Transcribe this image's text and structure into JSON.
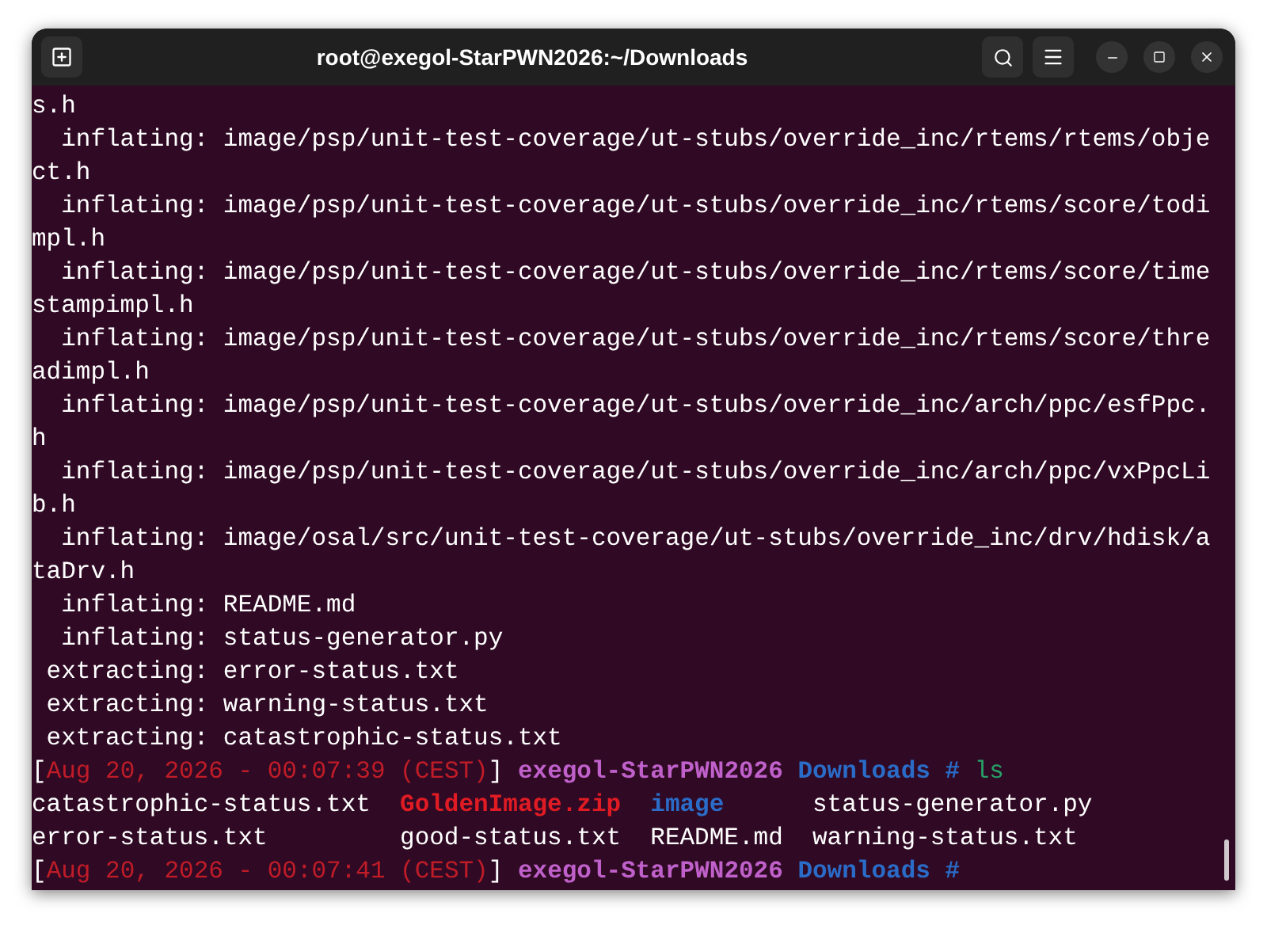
{
  "window": {
    "title": "root@exegol-StarPWN2026:~/Downloads"
  },
  "lines": [
    [
      {
        "kind": "plain",
        "text": "s.h"
      }
    ],
    [
      {
        "kind": "plain",
        "text": "  inflating: image/psp/unit-test-coverage/ut-stubs/override_inc/rtems/rtems/obje"
      }
    ],
    [
      {
        "kind": "plain",
        "text": "ct.h"
      }
    ],
    [
      {
        "kind": "plain",
        "text": "  inflating: image/psp/unit-test-coverage/ut-stubs/override_inc/rtems/score/todi"
      }
    ],
    [
      {
        "kind": "plain",
        "text": "mpl.h"
      }
    ],
    [
      {
        "kind": "plain",
        "text": "  inflating: image/psp/unit-test-coverage/ut-stubs/override_inc/rtems/score/time"
      }
    ],
    [
      {
        "kind": "plain",
        "text": "stampimpl.h"
      }
    ],
    [
      {
        "kind": "plain",
        "text": "  inflating: image/psp/unit-test-coverage/ut-stubs/override_inc/rtems/score/thre"
      }
    ],
    [
      {
        "kind": "plain",
        "text": "adimpl.h"
      }
    ],
    [
      {
        "kind": "plain",
        "text": "  inflating: image/psp/unit-test-coverage/ut-stubs/override_inc/arch/ppc/esfPpc."
      }
    ],
    [
      {
        "kind": "plain",
        "text": "h"
      }
    ],
    [
      {
        "kind": "plain",
        "text": "  inflating: image/psp/unit-test-coverage/ut-stubs/override_inc/arch/ppc/vxPpcLi"
      }
    ],
    [
      {
        "kind": "plain",
        "text": "b.h"
      }
    ],
    [
      {
        "kind": "plain",
        "text": "  inflating: image/osal/src/unit-test-coverage/ut-stubs/override_inc/drv/hdisk/a"
      }
    ],
    [
      {
        "kind": "plain",
        "text": "taDrv.h"
      }
    ],
    [
      {
        "kind": "plain",
        "text": "  inflating: README.md"
      }
    ],
    [
      {
        "kind": "plain",
        "text": "  inflating: status-generator.py"
      }
    ],
    [
      {
        "kind": "plain",
        "text": " extracting: error-status.txt"
      }
    ],
    [
      {
        "kind": "plain",
        "text": " extracting: warning-status.txt"
      }
    ],
    [
      {
        "kind": "plain",
        "text": " extracting: catastrophic-status.txt"
      }
    ],
    [
      {
        "kind": "bracket",
        "text": "["
      },
      {
        "kind": "date",
        "text": "Aug 20, 2026 - 00:07:39 (CEST)"
      },
      {
        "kind": "bracket",
        "text": "]"
      },
      {
        "kind": "host",
        "text": " exegol-StarPWN2026"
      },
      {
        "kind": "dir",
        "text": " Downloads #"
      },
      {
        "kind": "command",
        "text": " ls"
      }
    ],
    {
      "listing": [
        {
          "kind": "plain",
          "text": "catastrophic-status.txt"
        },
        {
          "kind": "archive",
          "text": "GoldenImage.zip"
        },
        {
          "kind": "dir",
          "text": "image"
        },
        {
          "kind": "plain",
          "text": "status-generator.py"
        }
      ]
    },
    {
      "listing": [
        {
          "kind": "plain",
          "text": "error-status.txt"
        },
        {
          "kind": "plain",
          "text": "good-status.txt"
        },
        {
          "kind": "plain",
          "text": "README.md"
        },
        {
          "kind": "plain",
          "text": "warning-status.txt"
        }
      ]
    },
    [
      {
        "kind": "bracket",
        "text": "["
      },
      {
        "kind": "date",
        "text": "Aug 20, 2026 - 00:07:41 (CEST)"
      },
      {
        "kind": "bracket",
        "text": "]"
      },
      {
        "kind": "host",
        "text": " exegol-StarPWN2026"
      },
      {
        "kind": "dir",
        "text": " Downloads #"
      }
    ]
  ]
}
